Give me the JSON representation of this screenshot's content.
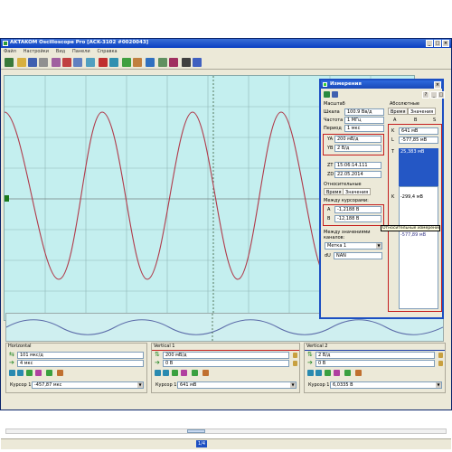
{
  "window": {
    "title": "AKTAKOM Oscilloscope Pro [ACK-3102 #0020043]"
  },
  "menu": [
    "Файл",
    "Настройки",
    "Вид",
    "Панели",
    "Справка"
  ],
  "measurements": {
    "title": "Измерения",
    "scale_header": "Масштаб",
    "scale_label": "Шкала",
    "scale_value": "100.9 Вв/д",
    "freq_label": "Частота",
    "freq_value": "1 МГц",
    "period_label": "Период",
    "period_value": "1 мкс",
    "ya_label": "YA",
    "ya_value": "200 мВ/д",
    "yb_label": "YB",
    "yb_value": "2 В/д",
    "zt_label": "ZT",
    "zt_value": "15:06:14.111",
    "zd_label": "ZD",
    "zd_value": "22.05.2014",
    "relative_header": "Относительные",
    "rel_tab_time": "Время",
    "rel_tab_values": "Значения",
    "between_cursors_header": "Между курсорами:",
    "a_label": "A",
    "a_value": "-1,2188 В",
    "b_label": "B",
    "b_value": "-12,188 В",
    "between_values_header": "Между значениями каналов:",
    "channel_select": "Метка 1",
    "du_label": "dU",
    "du_value": "NAN",
    "absolute_header": "Абсолютные",
    "abs_tab_time": "Время",
    "abs_tab_values": "Значения",
    "col_a": "A",
    "col_b": "B",
    "col_s": "S",
    "k_label": "K",
    "k_value": "641 мВ",
    "l_label": "L",
    "l_value": "-577,85 мВ",
    "t_label": "T",
    "t_value": "25,383 мВ",
    "k2_label": "K",
    "k2_value": "-299,4 мВ",
    "extra_value": "-577,89 мВ",
    "tooltip": "Относительные измерения"
  },
  "horizontal": {
    "header": "Horizontal",
    "timebase": "101 мкс/д",
    "offset": "4 мкс",
    "cursor_label": "Курсор 1",
    "cursor_value": "-457,87 мкс"
  },
  "vertical1": {
    "header": "Vertical 1",
    "scale": "200 мВ/д",
    "offset": "0 В",
    "cursor_label": "Курсор 1",
    "cursor_value": "641 мВ",
    "color": "#c41e1e"
  },
  "vertical2": {
    "header": "Vertical 2",
    "scale": "2 В/д",
    "offset": "0 В",
    "cursor_label": "Курсор 1",
    "cursor_value": "6,0335 В",
    "color": "#1a3aa8"
  },
  "status": {
    "page": "1/4"
  }
}
